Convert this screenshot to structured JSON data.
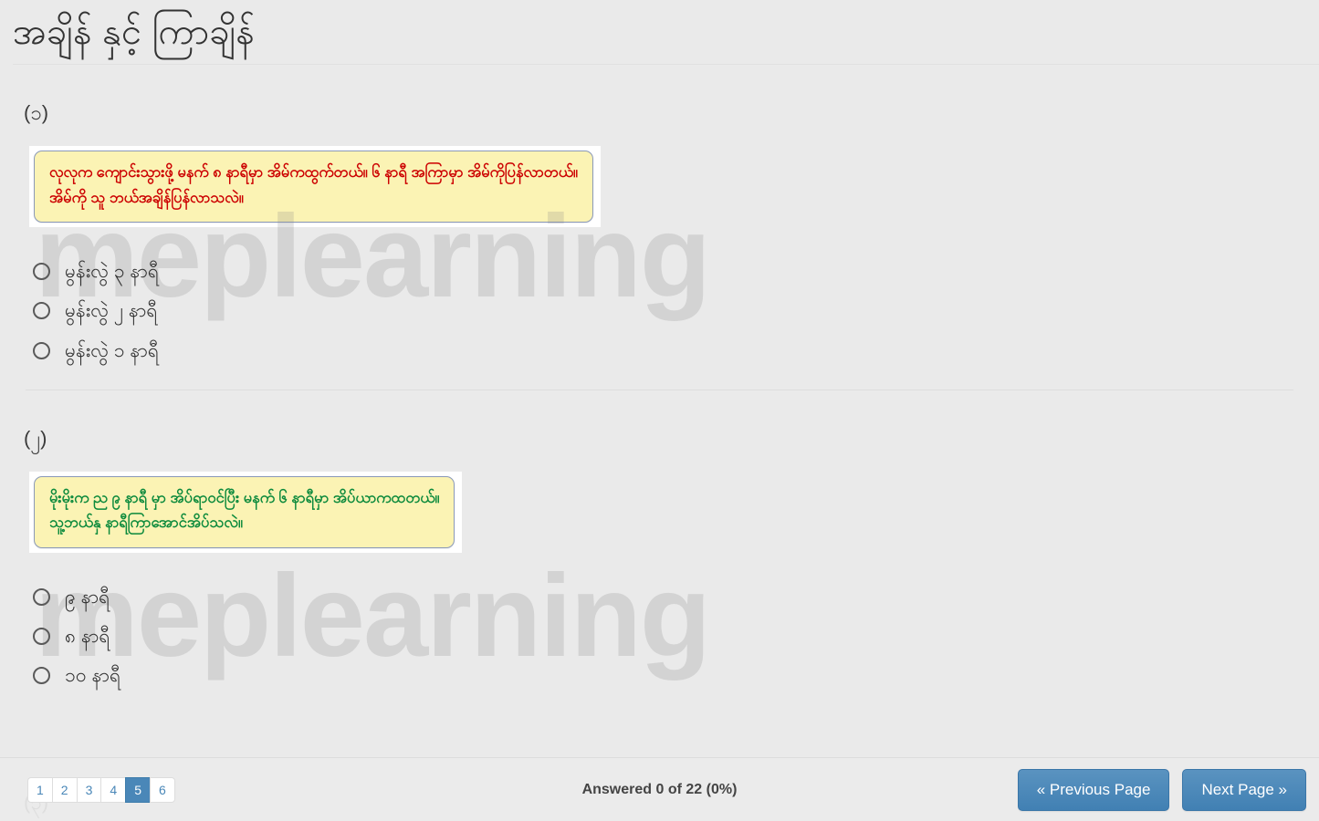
{
  "header": {
    "title": "အချိန် နှင့် ကြာချိန်"
  },
  "watermark": {
    "text": "meplearning"
  },
  "questions": [
    {
      "number": "(၁)",
      "stem_color": "#cc0000",
      "stem_lines": [
        "လုလုက ကျောင်းသွားဖို့ မနက် ၈ နာရီမှာ အိမ်ကထွက်တယ်။ ၆ နာရီ အကြာမှာ အိမ်ကိုပြန်လာတယ်။",
        "အိမ်ကို သူ ဘယ်အချိန်ပြန်လာသလဲ။"
      ],
      "options": [
        {
          "label": "မွန်းလွဲ ၃ နာရီ",
          "selected": false
        },
        {
          "label": "မွန်းလွဲ ၂ နာရီ",
          "selected": false
        },
        {
          "label": "မွန်းလွဲ ၁ နာရီ",
          "selected": false
        }
      ]
    },
    {
      "number": "(၂)",
      "stem_color": "#0c8a3c",
      "stem_lines": [
        "မိုးမိုးက ည ၉ နာရီ မှာ အိပ်ရာဝင်ပြီး မနက် ၆ နာရီမှာ အိပ်ယာကထတယ်။",
        "သူ့ဘယ်နှ နာရီကြာအောင်အိပ်သလဲ။"
      ],
      "options": [
        {
          "label": "၉ နာရီ",
          "selected": false
        },
        {
          "label": "၈ နာရီ",
          "selected": false
        },
        {
          "label": "၁၀ နာရီ",
          "selected": false
        }
      ]
    }
  ],
  "next_question_peek": "(၃)",
  "footer": {
    "pages": [
      {
        "label": "1",
        "active": false
      },
      {
        "label": "2",
        "active": false
      },
      {
        "label": "3",
        "active": false
      },
      {
        "label": "4",
        "active": false
      },
      {
        "label": "5",
        "active": true
      },
      {
        "label": "6",
        "active": false
      }
    ],
    "answered_status": "Answered 0 of 22 (0%)",
    "previous_label": "« Previous Page",
    "next_label": "Next Page »"
  },
  "colors": {
    "accent_blue": "#4a87b8",
    "stem_background": "#fbf3b4",
    "stem_border": "#8a99b8",
    "page_background": "#eaeaea"
  }
}
